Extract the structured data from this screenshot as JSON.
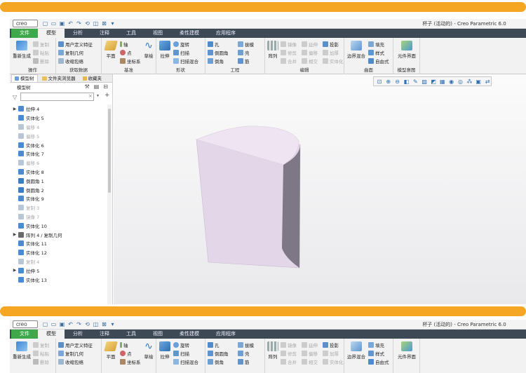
{
  "app": {
    "logo": "creo",
    "window_title": "杯子 (活动的) - Creo Parametric 6.0"
  },
  "tabs": [
    {
      "label": "文件"
    },
    {
      "label": "模型"
    },
    {
      "label": "分析"
    },
    {
      "label": "注释"
    },
    {
      "label": "工具"
    },
    {
      "label": "视图"
    },
    {
      "label": "柔性建模"
    },
    {
      "label": "应用程序"
    }
  ],
  "ribbon": {
    "operations": {
      "regenerate": "重新生成",
      "copy": "复制",
      "paste": "粘贴",
      "delete": "删除",
      "group": "操作"
    },
    "get_data": {
      "udf": "用户定义特征",
      "copy_geom": "复制几何",
      "shrinkwrap": "收缩包络",
      "group": "获取数据"
    },
    "datum": {
      "plane": "平面",
      "axis": "轴",
      "point": "点",
      "csys": "坐标系",
      "sketch": "草绘",
      "group": "基准"
    },
    "shapes": {
      "extrude": "拉伸",
      "revolve": "旋转",
      "sweep": "扫描",
      "swept_blend": "扫描混合",
      "group": "形状"
    },
    "engineering": {
      "hole": "孔",
      "round": "倒圆角",
      "chamfer": "倒角",
      "draft": "拔模",
      "shell": "壳",
      "rib": "筋",
      "group": "工程"
    },
    "editing": {
      "pattern": "阵列",
      "mirror": "镜像",
      "extend": "延伸",
      "project": "投影",
      "trim": "修剪",
      "offset": "偏移",
      "thicken": "加厚",
      "merge": "合并",
      "intersect": "相交",
      "solidify": "实体化",
      "group": "编辑"
    },
    "surfaces": {
      "boundary_blend": "边界混合",
      "fill": "填充",
      "style": "样式",
      "freestyle": "自由式",
      "group": "曲面"
    },
    "model_intent": {
      "component_interface": "元件界面",
      "group": "模型意图"
    }
  },
  "nav": {
    "tabs": [
      "模型树",
      "文件夹浏览器",
      "收藏夹"
    ],
    "tree_header": "模型树"
  },
  "tree": [
    {
      "label": "拉伸 4",
      "expandable": true,
      "dim": false,
      "color": "#4a8bd6"
    },
    {
      "label": "实体化 5",
      "expandable": false,
      "dim": false,
      "color": "#4a8bd6"
    },
    {
      "label": "偏移 4",
      "expandable": false,
      "dim": true,
      "color": "#b9c6d6"
    },
    {
      "label": "偏移 5",
      "expandable": false,
      "dim": true,
      "color": "#b9c6d6"
    },
    {
      "label": "实体化 6",
      "expandable": false,
      "dim": false,
      "color": "#4a8bd6"
    },
    {
      "label": "实体化 7",
      "expandable": false,
      "dim": false,
      "color": "#4a8bd6"
    },
    {
      "label": "偏移 6",
      "expandable": false,
      "dim": true,
      "color": "#b9c6d6"
    },
    {
      "label": "实体化 8",
      "expandable": false,
      "dim": false,
      "color": "#4a8bd6"
    },
    {
      "label": "倒圆角 1",
      "expandable": false,
      "dim": false,
      "color": "#3c7ec6"
    },
    {
      "label": "倒圆角 2",
      "expandable": false,
      "dim": false,
      "color": "#3c7ec6"
    },
    {
      "label": "实体化 9",
      "expandable": false,
      "dim": false,
      "color": "#4a8bd6"
    },
    {
      "label": "复制 3",
      "expandable": false,
      "dim": true,
      "color": "#b9c6d6"
    },
    {
      "label": "镜像 7",
      "expandable": false,
      "dim": true,
      "color": "#b9c6d6"
    },
    {
      "label": "实体化 10",
      "expandable": false,
      "dim": false,
      "color": "#4a8bd6"
    },
    {
      "label": "阵列 4 / 复制几何",
      "expandable": true,
      "dim": false,
      "color": "#6a6a6a"
    },
    {
      "label": "实体化 11",
      "expandable": false,
      "dim": false,
      "color": "#4a8bd6"
    },
    {
      "label": "实体化 12",
      "expandable": false,
      "dim": false,
      "color": "#4a8bd6"
    },
    {
      "label": "复制 4",
      "expandable": false,
      "dim": true,
      "color": "#b9c6d6"
    },
    {
      "label": "拉伸 5",
      "expandable": true,
      "dim": false,
      "color": "#4a8bd6"
    },
    {
      "label": "实体化 13",
      "expandable": false,
      "dim": false,
      "color": "#4a8bd6"
    }
  ],
  "colors": {
    "accent_orange": "#f5a623",
    "file_tab_green": "#3fa84a",
    "tabbar_dark": "#3d4a56",
    "model_top": "#efe4f2",
    "model_front": "#e3d6e8",
    "model_side": "#7e7786"
  }
}
